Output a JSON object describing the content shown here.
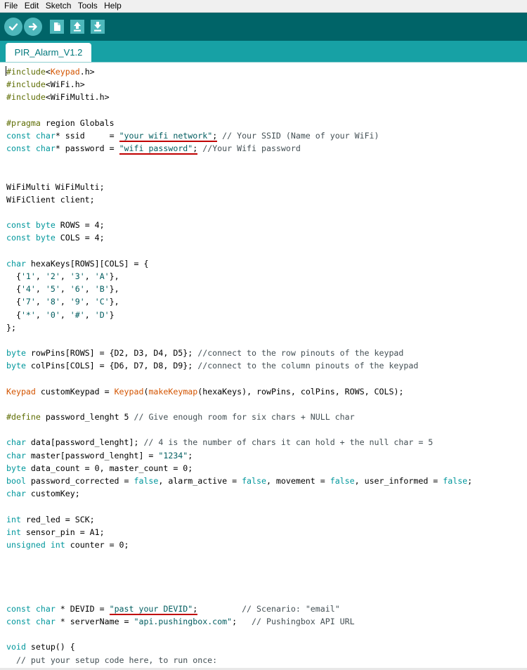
{
  "menu": [
    "File",
    "Edit",
    "Sketch",
    "Tools",
    "Help"
  ],
  "toolbar": {
    "buttons": [
      "verify-icon",
      "upload-icon",
      "new-icon",
      "open-icon",
      "save-icon"
    ],
    "accent": "#006468",
    "button_color": "#4db7bb"
  },
  "tab": {
    "label": "PIR_Alarm_V1.2"
  },
  "code_lines": [
    [
      [
        "inc",
        "#include"
      ],
      [
        "",
        "<"
      ],
      [
        "lib",
        "Keypad"
      ],
      [
        "",
        ".h>"
      ]
    ],
    [
      [
        "inc",
        "#include"
      ],
      [
        "",
        "<WiFi.h>"
      ]
    ],
    [
      [
        "inc",
        "#include"
      ],
      [
        "",
        "<WiFiMulti.h>"
      ]
    ],
    [],
    [
      [
        "inc",
        "#pragma"
      ],
      [
        "",
        " region Globals"
      ]
    ],
    [
      [
        "kw",
        "const"
      ],
      [
        "",
        ""
      ],
      [
        "kw",
        " char"
      ],
      [
        "",
        "* ssid     = "
      ],
      [
        "str ul",
        "\"your wifi network\""
      ],
      [
        "ul",
        ";"
      ],
      [
        "cm",
        " // Your SSID (Name of your WiFi)"
      ]
    ],
    [
      [
        "kw",
        "const"
      ],
      [
        "kw",
        " char"
      ],
      [
        "",
        "* password = "
      ],
      [
        "str ul",
        "\"wifi password\""
      ],
      [
        "ul",
        ";"
      ],
      [
        "cm",
        " //Your Wifi password"
      ]
    ],
    [],
    [],
    [
      [
        "",
        "WiFiMulti WiFiMulti;"
      ]
    ],
    [
      [
        "",
        "WiFiClient client;"
      ]
    ],
    [],
    [
      [
        "kw",
        "const"
      ],
      [
        "kw",
        " byte"
      ],
      [
        "",
        " ROWS = 4;"
      ]
    ],
    [
      [
        "kw",
        "const"
      ],
      [
        "kw",
        " byte"
      ],
      [
        "",
        " COLS = 4;"
      ]
    ],
    [],
    [
      [
        "kw",
        "char"
      ],
      [
        "",
        " hexaKeys[ROWS][COLS] = {"
      ]
    ],
    [
      [
        "",
        "  {"
      ],
      [
        "str",
        "'1'"
      ],
      [
        "",
        ", "
      ],
      [
        "str",
        "'2'"
      ],
      [
        "",
        ", "
      ],
      [
        "str",
        "'3'"
      ],
      [
        "",
        ", "
      ],
      [
        "str",
        "'A'"
      ],
      [
        "",
        "},"
      ]
    ],
    [
      [
        "",
        "  {"
      ],
      [
        "str",
        "'4'"
      ],
      [
        "",
        ", "
      ],
      [
        "str",
        "'5'"
      ],
      [
        "",
        ", "
      ],
      [
        "str",
        "'6'"
      ],
      [
        "",
        ", "
      ],
      [
        "str",
        "'B'"
      ],
      [
        "",
        "},"
      ]
    ],
    [
      [
        "",
        "  {"
      ],
      [
        "str",
        "'7'"
      ],
      [
        "",
        ", "
      ],
      [
        "str",
        "'8'"
      ],
      [
        "",
        ", "
      ],
      [
        "str",
        "'9'"
      ],
      [
        "",
        ", "
      ],
      [
        "str",
        "'C'"
      ],
      [
        "",
        "},"
      ]
    ],
    [
      [
        "",
        "  {"
      ],
      [
        "str",
        "'*'"
      ],
      [
        "",
        ", "
      ],
      [
        "str",
        "'0'"
      ],
      [
        "",
        ", "
      ],
      [
        "str",
        "'#'"
      ],
      [
        "",
        ", "
      ],
      [
        "str",
        "'D'"
      ],
      [
        "",
        "}"
      ]
    ],
    [
      [
        "",
        "};"
      ]
    ],
    [],
    [
      [
        "kw",
        "byte"
      ],
      [
        "",
        " rowPins[ROWS] = {D2, D3, D4, D5}; "
      ],
      [
        "cm",
        "//connect to the row pinouts of the keypad"
      ]
    ],
    [
      [
        "kw",
        "byte"
      ],
      [
        "",
        " colPins[COLS] = {D6, D7, D8, D9}; "
      ],
      [
        "cm",
        "//connect to the column pinouts of the keypad"
      ]
    ],
    [],
    [
      [
        "lib",
        "Keypad"
      ],
      [
        "",
        " customKeypad = "
      ],
      [
        "lib",
        "Keypad"
      ],
      [
        "",
        "("
      ],
      [
        "lib",
        "makeKeymap"
      ],
      [
        "",
        "(hexaKeys), rowPins, colPins, ROWS, COLS);"
      ]
    ],
    [],
    [
      [
        "inc",
        "#define"
      ],
      [
        "",
        " password_lenght 5 "
      ],
      [
        "cm",
        "// Give enough room for six chars + NULL char"
      ]
    ],
    [],
    [
      [
        "kw",
        "char"
      ],
      [
        "",
        " data[password_lenght]; "
      ],
      [
        "cm",
        "// 4 is the number of chars it can hold + the null char = 5"
      ]
    ],
    [
      [
        "kw",
        "char"
      ],
      [
        "",
        " master[password_lenght] = "
      ],
      [
        "str",
        "\"1234\""
      ],
      [
        "",
        ";"
      ]
    ],
    [
      [
        "kw",
        "byte"
      ],
      [
        "",
        " data_count = 0, master_count = 0;"
      ]
    ],
    [
      [
        "kw",
        "bool"
      ],
      [
        "",
        " password_corrected = "
      ],
      [
        "kw",
        "false"
      ],
      [
        "",
        ", alarm_active = "
      ],
      [
        "kw",
        "false"
      ],
      [
        "",
        ", movement = "
      ],
      [
        "kw",
        "false"
      ],
      [
        "",
        ", user_informed = "
      ],
      [
        "kw",
        "false"
      ],
      [
        "",
        ";"
      ]
    ],
    [
      [
        "kw",
        "char"
      ],
      [
        "",
        " customKey;"
      ]
    ],
    [],
    [
      [
        "kw",
        "int"
      ],
      [
        "",
        " red_led = SCK;"
      ]
    ],
    [
      [
        "kw",
        "int"
      ],
      [
        "",
        " sensor_pin = A1;"
      ]
    ],
    [
      [
        "kw",
        "unsigned"
      ],
      [
        "kw",
        " int"
      ],
      [
        "",
        " counter = 0;"
      ]
    ],
    [],
    [],
    [],
    [],
    [
      [
        "kw",
        "const"
      ],
      [
        "kw",
        " char"
      ],
      [
        "",
        " * DEVID = "
      ],
      [
        "str ul",
        "\"past your DEVID\""
      ],
      [
        "ul",
        ";"
      ],
      [
        "",
        "         "
      ],
      [
        "cm",
        "// Scenario: \"email\""
      ]
    ],
    [
      [
        "kw",
        "const"
      ],
      [
        "kw",
        " char"
      ],
      [
        "",
        " * serverName = "
      ],
      [
        "str",
        "\"api.pushingbox.com\""
      ],
      [
        "",
        ";   "
      ],
      [
        "cm",
        "// Pushingbox API URL"
      ]
    ],
    [],
    [
      [
        "kw",
        "void"
      ],
      [
        "",
        " setup() {"
      ]
    ],
    [
      [
        "cm",
        "  // put your setup code here, to run once:"
      ]
    ]
  ]
}
